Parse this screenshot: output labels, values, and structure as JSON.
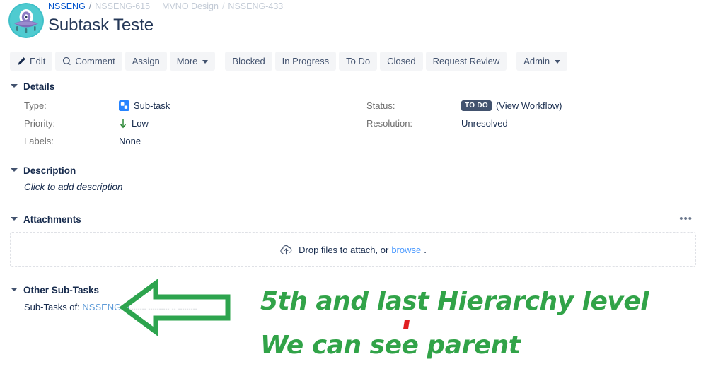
{
  "header": {
    "avatar_name": "project-avatar",
    "breadcrumb": {
      "project": "NSSENG",
      "sep": "/",
      "item2": "NSSENG-615",
      "item3": "MVNO Design",
      "item4": "NSSENG-433"
    },
    "title": "Subtask Teste"
  },
  "toolbar": {
    "edit": "Edit",
    "comment": "Comment",
    "assign": "Assign",
    "more": "More",
    "blocked": "Blocked",
    "in_progress": "In Progress",
    "to_do": "To Do",
    "closed": "Closed",
    "request_review": "Request Review",
    "admin": "Admin"
  },
  "details": {
    "heading": "Details",
    "type_label": "Type:",
    "type_value": "Sub-task",
    "priority_label": "Priority:",
    "priority_value": "Low",
    "labels_label": "Labels:",
    "labels_value": "None",
    "status_label": "Status:",
    "status_value": "TO DO",
    "view_workflow": "(View Workflow)",
    "resolution_label": "Resolution:",
    "resolution_value": "Unresolved"
  },
  "description": {
    "heading": "Description",
    "placeholder": "Click to add description"
  },
  "attachments": {
    "heading": "Attachments",
    "more_menu": "•••",
    "drop_text": "Drop files to attach, or",
    "browse_link": "browse",
    "drop_suffix": "."
  },
  "other_subtasks": {
    "heading": "Other Sub-Tasks",
    "subtasks_of_label": "Sub-Tasks of:",
    "parent_key": "NSSENG-6",
    "obscured_summary": "........ .......... .. ........."
  },
  "annotation": {
    "line1": "5th and last Hierarchy level",
    "line2": "We can see parent",
    "arrow_direction": "left",
    "green": "#31A348",
    "red": "#E01E21"
  },
  "colors": {
    "status_badge": "#42526E",
    "link": "#0052CC",
    "text": "#172B4D",
    "muted": "#707070",
    "button_bg": "#F4F5F7"
  }
}
